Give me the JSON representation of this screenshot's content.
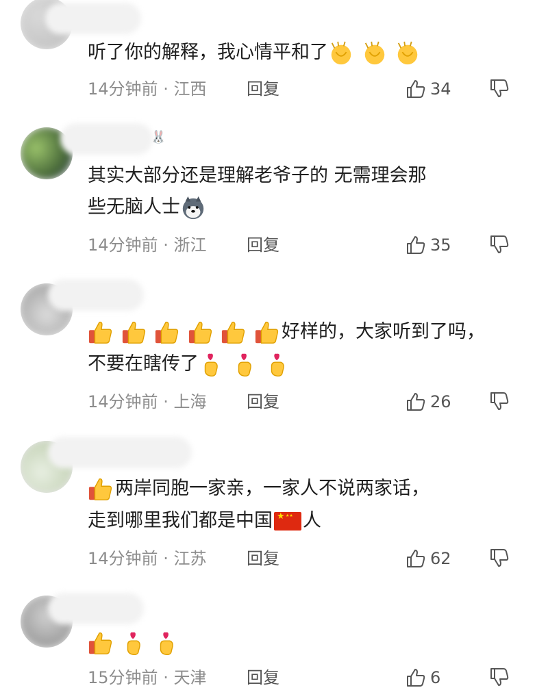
{
  "comments": [
    {
      "name_suffix": "",
      "text_lines": [
        "听了你的解释，我心情平和了"
      ],
      "time": "14分钟前",
      "sep": "·",
      "location": "江西",
      "reply": "回复",
      "likes": "34",
      "emojis_after_line1": [
        "clap-emoji",
        "clap-emoji",
        "clap-emoji"
      ]
    },
    {
      "name_suffix": "🐰",
      "text_lines": [
        "其实大部分还是理解老爷子的 无需理会那",
        "些无脑人士"
      ],
      "time": "14分钟前",
      "sep": "·",
      "location": "浙江",
      "reply": "回复",
      "likes": "35",
      "emojis_after_line2": [
        "husky-emoji"
      ]
    },
    {
      "name_suffix": "",
      "text_lines": [
        "好样的，大家听到了吗，",
        "不要在瞎传了"
      ],
      "time": "14分钟前",
      "sep": "·",
      "location": "上海",
      "reply": "回复",
      "likes": "26",
      "emojis_before_line1": [
        "thumbs-up-emoji",
        "thumbs-up-emoji",
        "thumbs-up-emoji",
        "thumbs-up-emoji",
        "thumbs-up-emoji",
        "thumbs-up-emoji"
      ],
      "emojis_after_line2": [
        "finger-heart-emoji",
        "finger-heart-emoji",
        "finger-heart-emoji"
      ]
    },
    {
      "name_suffix": "",
      "text_lines": [
        "两岸同胞一家亲，一家人不说两家话，",
        "走到哪里我们都是中国",
        "人"
      ],
      "time": "14分钟前",
      "sep": "·",
      "location": "江苏",
      "reply": "回复",
      "likes": "62",
      "emojis_before_line1": [
        "thumbs-up-emoji"
      ],
      "flag": "china-flag-emoji"
    },
    {
      "name_suffix": "",
      "text_lines": [],
      "time": "15分钟前",
      "sep": "·",
      "location": "天津",
      "reply": "回复",
      "likes": "6",
      "emojis_line1": [
        "thumbs-up-emoji",
        "finger-heart-emoji",
        "finger-heart-emoji"
      ]
    }
  ],
  "colors": {
    "text": "#1f1f1f",
    "meta": "#8c8c8c",
    "icon": "#555555",
    "flag_red": "#de2910",
    "flag_yellow": "#ffde00"
  }
}
